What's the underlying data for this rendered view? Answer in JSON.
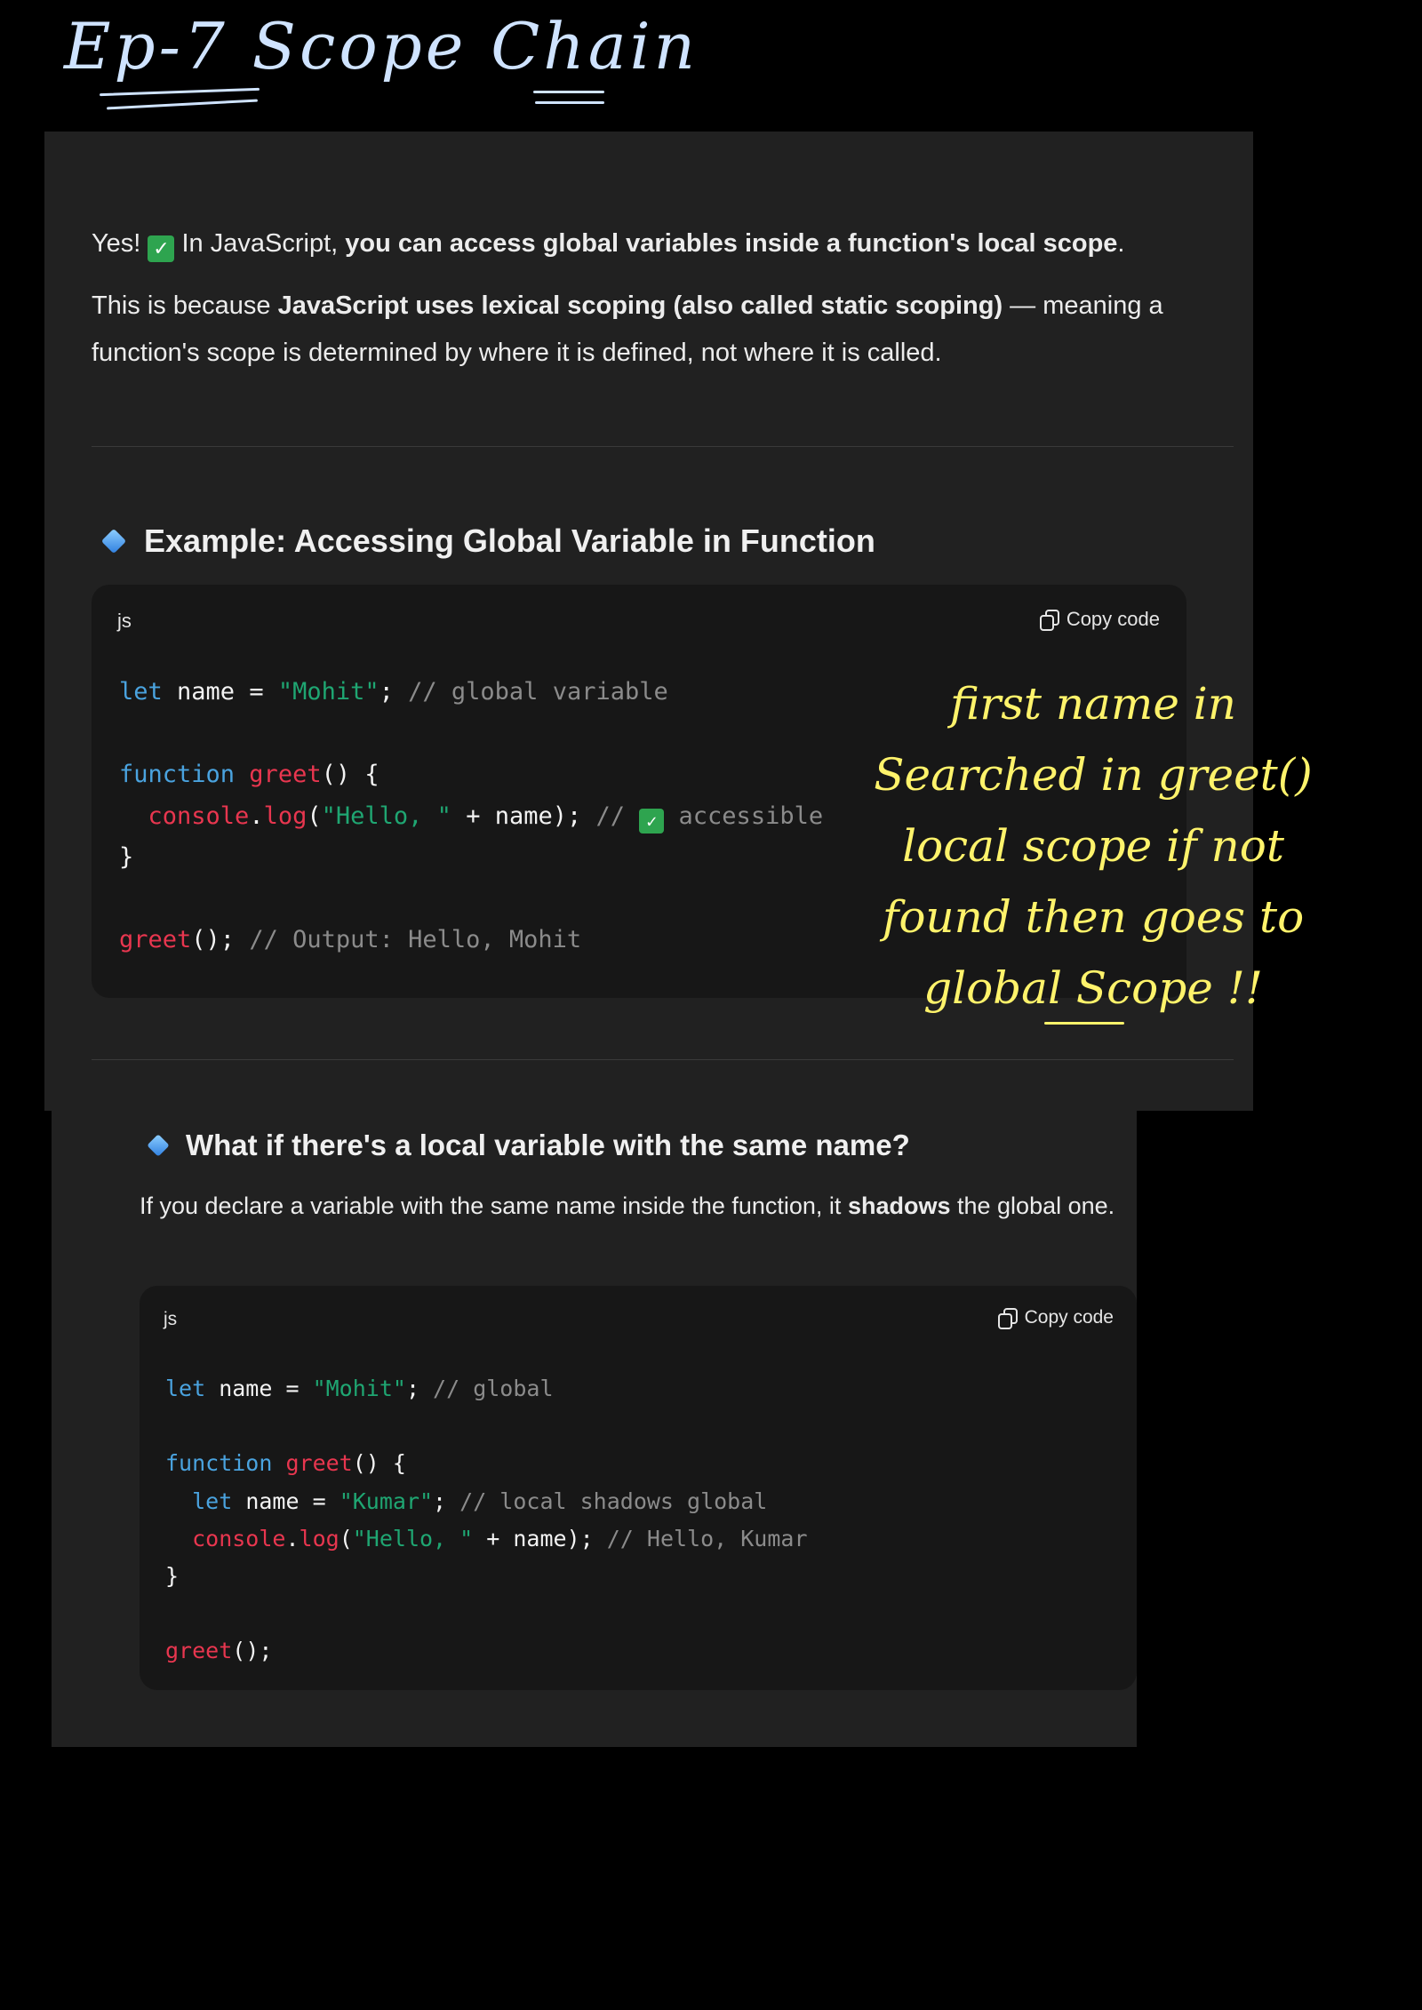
{
  "handwritten": {
    "title": "Ep-7  Scope Chain",
    "note": [
      "first name in",
      "Searched in greet()",
      "local scope if not",
      "found then goes to",
      "global Scope !!"
    ]
  },
  "intro": {
    "line1_pre": "Yes!",
    "line1_mid": "In JavaScript,",
    "line1_bold": "you can access global variables inside a function's local scope",
    "line1_post": ".",
    "line2_pre": "This is because",
    "line2_bold": "JavaScript uses lexical scoping (also called static scoping)",
    "line2_post": "— meaning a function's scope is determined by where it is defined, not where it is called."
  },
  "section1": {
    "heading": "Example: Accessing Global Variable in Function",
    "code": {
      "lang": "js",
      "copy_label": "Copy code",
      "t": {
        "l1_kw": "let",
        "l1_a": " name = ",
        "l1_str": "\"Mohit\"",
        "l1_b": "; ",
        "l1_cm": "// global variable",
        "l2_kw": "function",
        "l2_fn": " greet",
        "l2_a": "() {",
        "l3_fn": "  console",
        "l3_a": ".",
        "l3_fn2": "log",
        "l3_b": "(",
        "l3_str": "\"Hello, \"",
        "l3_c": " + name); ",
        "l3_cm1": "// ",
        "l3_cm2": " accessible",
        "l4": "}",
        "l5_fn": "greet",
        "l5_a": "(); ",
        "l5_cm": "// Output: Hello, Mohit"
      }
    }
  },
  "section2": {
    "heading": "What if there's a local variable with the same name?",
    "para_pre": "If you declare a variable with the same name inside the function, it",
    "para_bold": "shadows",
    "para_post": "the global one.",
    "code": {
      "lang": "js",
      "copy_label": "Copy code",
      "t": {
        "l1_kw": "let",
        "l1_a": " name = ",
        "l1_str": "\"Mohit\"",
        "l1_b": "; ",
        "l1_cm": "// global",
        "l2_kw": "function",
        "l2_fn": " greet",
        "l2_a": "() {",
        "l3_kw": "  let",
        "l3_a": " name = ",
        "l3_str": "\"Kumar\"",
        "l3_b": "; ",
        "l3_cm": "// local shadows global",
        "l4_fn": "  console",
        "l4_a": ".",
        "l4_fn2": "log",
        "l4_b": "(",
        "l4_str": "\"Hello, \"",
        "l4_c": " + name); ",
        "l4_cm": "// Hello, Kumar",
        "l5": "}",
        "l6_fn": "greet",
        "l6_a": "();"
      }
    }
  }
}
